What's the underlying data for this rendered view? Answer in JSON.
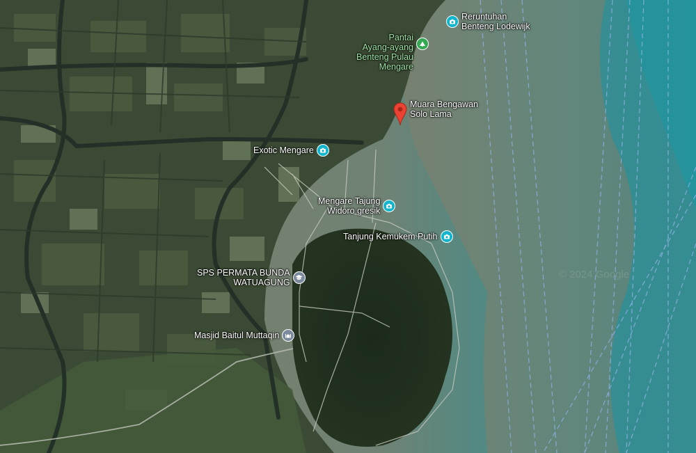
{
  "map": {
    "pois": [
      {
        "id": "reruntuhan",
        "lines": [
          "Reruntuhan",
          "Benteng Lodewijk"
        ],
        "icon": "camera-icon",
        "color": "#12b5cb"
      },
      {
        "id": "pantai",
        "lines": [
          "Pantai",
          "Ayang-ayang",
          "Benteng Pulau",
          "Mengare"
        ],
        "icon": "park-icon",
        "color": "#34a853"
      },
      {
        "id": "muara",
        "lines": [
          "Muara Bengawan",
          "Solo Lama"
        ],
        "icon": "red-location-pin-icon",
        "color": "#ea4335"
      },
      {
        "id": "exotic",
        "lines": [
          "Exotic Mengare"
        ],
        "icon": "camera-icon",
        "color": "#12b5cb"
      },
      {
        "id": "tajung",
        "lines": [
          "Mengare Tajung",
          "Widoro gresik"
        ],
        "icon": "camera-icon",
        "color": "#12b5cb"
      },
      {
        "id": "kemukem",
        "lines": [
          "Tanjung Kemukem Putih"
        ],
        "icon": "camera-icon",
        "color": "#12b5cb"
      },
      {
        "id": "sps",
        "lines": [
          "SPS PERMATA BUNDA",
          "WATUAGUNG"
        ],
        "icon": "school-icon",
        "color": "#7b8a9c"
      },
      {
        "id": "masjid",
        "lines": [
          "Masjid Baitul Muttaqin"
        ],
        "icon": "mosque-icon",
        "color": "#7b8a9c"
      }
    ],
    "watermark": "© 2024 Google"
  }
}
